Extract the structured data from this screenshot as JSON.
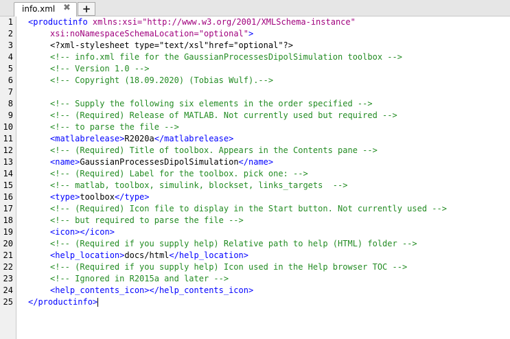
{
  "tabs": {
    "active_label": "info.xml",
    "close_glyph": "✖",
    "new_tab_glyph": "+"
  },
  "editor": {
    "line_numbers": [
      "1",
      "2",
      "3",
      "4",
      "5",
      "6",
      "7",
      "8",
      "9",
      "10",
      "11",
      "12",
      "13",
      "14",
      "15",
      "16",
      "17",
      "18",
      "19",
      "20",
      "21",
      "22",
      "23",
      "24",
      "25"
    ],
    "lines": {
      "l1_tag": "<productinfo",
      "l1_attr": " xmlns:xsi=",
      "l1_str": "\"http://www.w3.org/2001/XMLSchema-instance\"",
      "l2_attr": "xsi:noNamespaceSchemaLocation=",
      "l2_str": "\"optional\"",
      "l2_tag": ">",
      "l3": "<?xml-stylesheet type=\"text/xsl\"href=\"optional\"?>",
      "l4": "<!-- info.xml file for the GaussianProcessesDipolSimulation toolbox -->",
      "l5": "<!-- Version 1.0 -->",
      "l6": "<!-- Copyright (18.09.2020) (Tobias Wulf).-->",
      "l8": "<!-- Supply the following six elements in the order specified -->",
      "l9": "<!-- (Required) Release of MATLAB. Not currently used but required -->",
      "l10": "<!-- to parse the file -->",
      "l11_open": "<matlabrelease>",
      "l11_text": "R2020a",
      "l11_close": "</matlabrelease>",
      "l12": "<!-- (Required) Title of toolbox. Appears in the Contents pane -->",
      "l13_open": "<name>",
      "l13_text": "GaussianProcessesDipolSimulation",
      "l13_close": "</name>",
      "l14": "<!-- (Required) Label for the toolbox. pick one: -->",
      "l15": "<!-- matlab, toolbox, simulink, blockset, links_targets  -->",
      "l16_open": "<type>",
      "l16_text": "toolbox",
      "l16_close": "</type>",
      "l17": "<!-- (Required) Icon file to display in the Start button. Not currently used -->",
      "l18": "<!-- but required to parse the file -->",
      "l19": "<icon></icon>",
      "l20": "<!-- (Required if you supply help) Relative path to help (HTML) folder -->",
      "l21_open": "<help_location>",
      "l21_text": "docs/html",
      "l21_close": "</help_location>",
      "l22": "<!-- (Required if you supply help) Icon used in the Help browser TOC -->",
      "l23": "<!-- Ignored in R2015a and later -->",
      "l24": "<help_contents_icon></help_contents_icon>",
      "l25": "</productinfo>"
    }
  },
  "colors": {
    "tag": "#0000ff",
    "attribute": "#a0007d",
    "comment": "#228b22",
    "text": "#000000"
  }
}
